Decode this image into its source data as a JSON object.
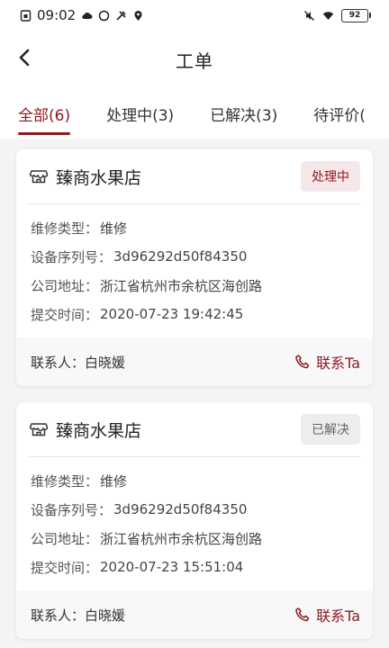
{
  "status_bar": {
    "time": "09:02",
    "battery": "92"
  },
  "header": {
    "title": "工单"
  },
  "tabs": [
    {
      "label": "全部(6)",
      "active": true
    },
    {
      "label": "处理中(3)",
      "active": false
    },
    {
      "label": "已解决(3)",
      "active": false
    },
    {
      "label": "待评价(",
      "active": false
    }
  ],
  "orders": [
    {
      "shop": "臻商水果店",
      "status": "处理中",
      "type_label": "维修类型：",
      "type_value": "维修",
      "serial_label": "设备序列号：",
      "serial_value": "3d96292d50f84350",
      "address_label": "公司地址：",
      "address_value": "浙江省杭州市余杭区海创路",
      "time_label": "提交时间：",
      "time_value": "2020-07-23 19:42:45",
      "contact_label": "联系人：",
      "contact_name": "白晓媛",
      "contact_button": "联系Ta"
    },
    {
      "shop": "臻商水果店",
      "status": "已解决",
      "type_label": "维修类型：",
      "type_value": "维修",
      "serial_label": "设备序列号：",
      "serial_value": "3d96292d50f84350",
      "address_label": "公司地址：",
      "address_value": "浙江省杭州市余杭区海创路",
      "time_label": "提交时间：",
      "time_value": "2020-07-23 15:51:04",
      "contact_label": "联系人：",
      "contact_name": "白晓媛",
      "contact_button": "联系Ta"
    }
  ],
  "colors": {
    "accent": "#8c1a1e",
    "processing_bg": "#f6e8e9",
    "solved_bg": "#ededed"
  },
  "icons": {
    "back": "chevron-left-icon",
    "shop": "shop-icon",
    "phone": "phone-icon"
  }
}
